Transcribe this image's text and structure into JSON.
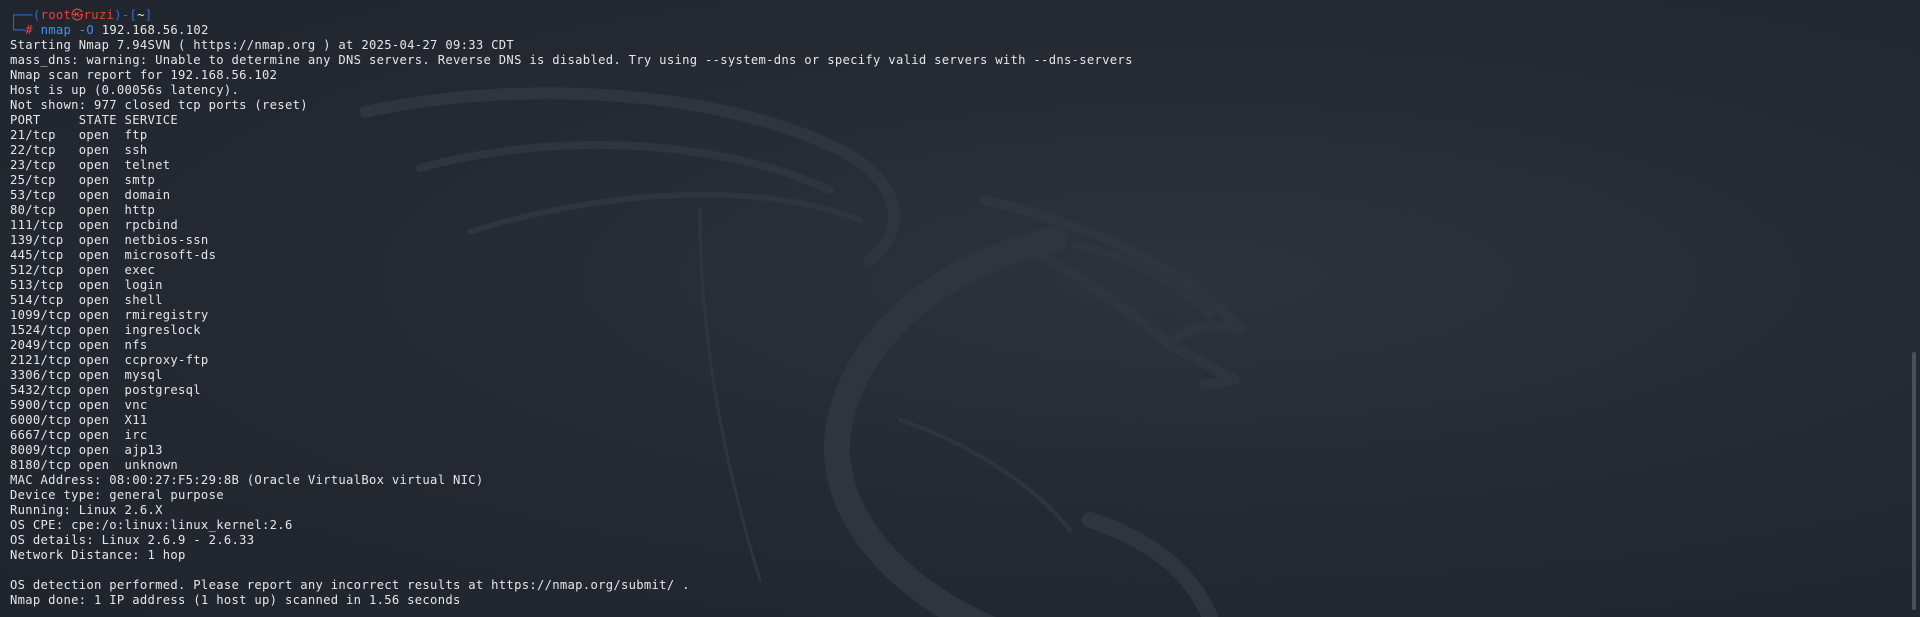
{
  "prompt": {
    "user": "root",
    "symbol": "㉿",
    "host": "ruzi",
    "dir": "~",
    "command": "nmap",
    "flag": "-O",
    "target": "192.168.56.102"
  },
  "output": [
    "Starting Nmap 7.94SVN ( https://nmap.org ) at 2025-04-27 09:33 CDT",
    "mass_dns: warning: Unable to determine any DNS servers. Reverse DNS is disabled. Try using --system-dns or specify valid servers with --dns-servers",
    "Nmap scan report for 192.168.56.102",
    "Host is up (0.00056s latency).",
    "Not shown: 977 closed tcp ports (reset)",
    "PORT     STATE SERVICE",
    "21/tcp   open  ftp",
    "22/tcp   open  ssh",
    "23/tcp   open  telnet",
    "25/tcp   open  smtp",
    "53/tcp   open  domain",
    "80/tcp   open  http",
    "111/tcp  open  rpcbind",
    "139/tcp  open  netbios-ssn",
    "445/tcp  open  microsoft-ds",
    "512/tcp  open  exec",
    "513/tcp  open  login",
    "514/tcp  open  shell",
    "1099/tcp open  rmiregistry",
    "1524/tcp open  ingreslock",
    "2049/tcp open  nfs",
    "2121/tcp open  ccproxy-ftp",
    "3306/tcp open  mysql",
    "5432/tcp open  postgresql",
    "5900/tcp open  vnc",
    "6000/tcp open  X11",
    "6667/tcp open  irc",
    "8009/tcp open  ajp13",
    "8180/tcp open  unknown",
    "MAC Address: 08:00:27:F5:29:8B (Oracle VirtualBox virtual NIC)",
    "Device type: general purpose",
    "Running: Linux 2.6.X",
    "OS CPE: cpe:/o:linux:linux_kernel:2.6",
    "OS details: Linux 2.6.9 - 2.6.33",
    "Network Distance: 1 hop",
    "",
    "OS detection performed. Please report any incorrect results at https://nmap.org/submit/ .",
    "Nmap done: 1 IP address (1 host up) scanned in 1.56 seconds"
  ],
  "colors": {
    "background": "#252a33",
    "text": "#e6e6e6",
    "prompt_frame": "#2f6fd0",
    "prompt_user": "#e0473b",
    "command": "#4c8fe8"
  },
  "icons": {
    "background": "kali-dragon-logo"
  }
}
